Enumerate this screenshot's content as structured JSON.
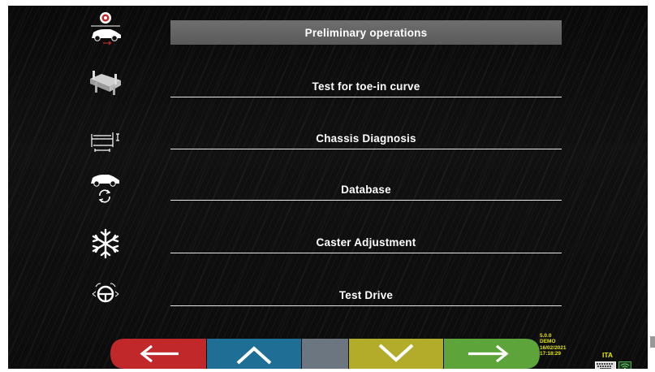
{
  "menu": {
    "items": [
      {
        "label": "Preliminary operations",
        "icon": "wheel-car-icon",
        "selected": true
      },
      {
        "label": "Test for toe-in curve",
        "icon": "lift-ramp-icon",
        "selected": false
      },
      {
        "label": "Chassis Diagnosis",
        "icon": "chassis-measure-icon",
        "selected": false
      },
      {
        "label": "Database",
        "icon": "car-sync-icon",
        "selected": false
      },
      {
        "label": "Caster Adjustment",
        "icon": "snowflake-icon",
        "selected": false
      },
      {
        "label": "Test Drive",
        "icon": "steering-wheel-icon",
        "selected": false
      }
    ]
  },
  "nav": {
    "buttons": [
      {
        "icon": "arrow-left-icon",
        "color": "#c0282a"
      },
      {
        "icon": "chevron-up-icon",
        "color": "#1f6e96"
      },
      {
        "icon": "blank",
        "color": "#6b7680"
      },
      {
        "icon": "chevron-down-icon",
        "color": "#b3ac2a"
      },
      {
        "icon": "arrow-right-icon",
        "color": "#5da43a"
      }
    ]
  },
  "status": {
    "version": "5.0.0",
    "mode": "DEMO",
    "date": "16/02/2021",
    "time": "17:18:29",
    "language": "ITA"
  }
}
